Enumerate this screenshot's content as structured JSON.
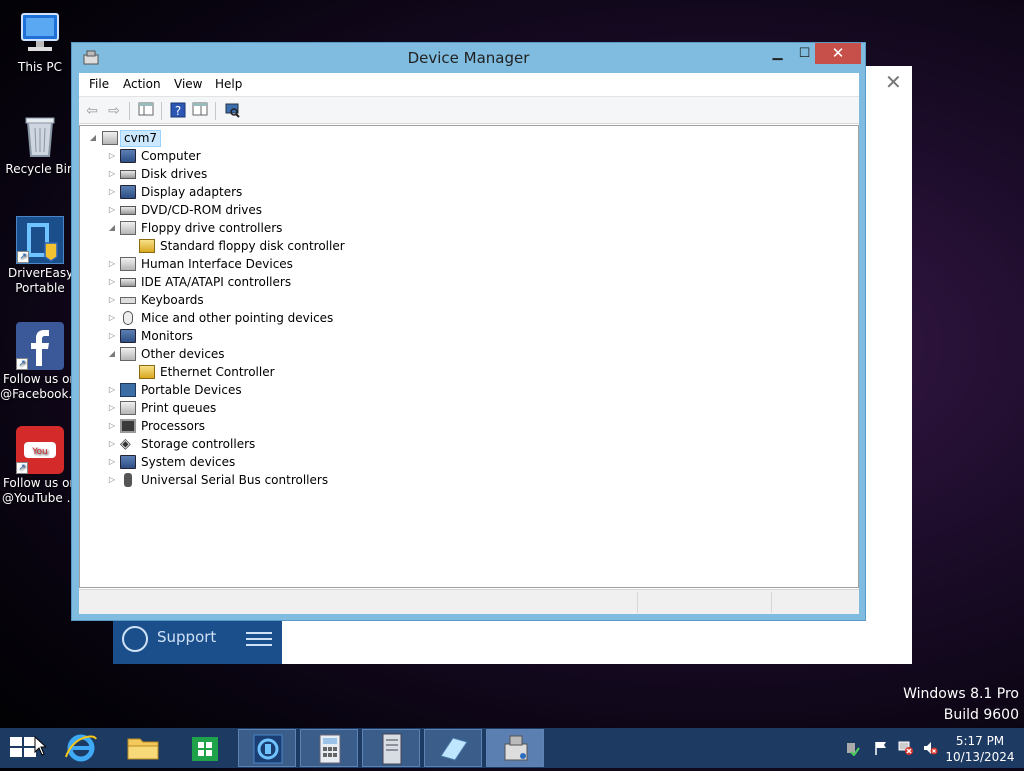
{
  "desktop": {
    "icons": [
      {
        "label": "This PC"
      },
      {
        "label": "Recycle Bin"
      },
      {
        "label": "DriverEasy Portable"
      },
      {
        "label": "Follow us on @Facebook..."
      },
      {
        "label": "Follow us on @YouTube ..."
      }
    ],
    "support_label": "Support",
    "edition": "Windows 8.1 Pro",
    "build": "Build 9600"
  },
  "window": {
    "title": "Device Manager",
    "menu": [
      "File",
      "Action",
      "View",
      "Help"
    ],
    "root": "cvm7",
    "nodes": [
      {
        "label": "Computer",
        "state": "collapsed",
        "icon": "computer-icon"
      },
      {
        "label": "Disk drives",
        "state": "collapsed",
        "icon": "disk-drive-icon"
      },
      {
        "label": "Display adapters",
        "state": "collapsed",
        "icon": "display-adapter-icon"
      },
      {
        "label": "DVD/CD-ROM drives",
        "state": "collapsed",
        "icon": "dvd-drive-icon"
      },
      {
        "label": "Floppy drive controllers",
        "state": "expanded",
        "icon": "floppy-controller-icon"
      },
      {
        "label": "Standard floppy disk controller",
        "state": "child",
        "icon": "floppy-controller-icon"
      },
      {
        "label": "Human Interface Devices",
        "state": "collapsed",
        "icon": "hid-icon"
      },
      {
        "label": "IDE ATA/ATAPI controllers",
        "state": "collapsed",
        "icon": "ide-controller-icon"
      },
      {
        "label": "Keyboards",
        "state": "collapsed",
        "icon": "keyboard-icon"
      },
      {
        "label": "Mice and other pointing devices",
        "state": "collapsed",
        "icon": "mouse-icon"
      },
      {
        "label": "Monitors",
        "state": "collapsed",
        "icon": "monitor-icon"
      },
      {
        "label": "Other devices",
        "state": "expanded",
        "icon": "other-devices-icon"
      },
      {
        "label": "Ethernet Controller",
        "state": "child",
        "icon": "warning-device-icon"
      },
      {
        "label": "Portable Devices",
        "state": "collapsed",
        "icon": "portable-device-icon"
      },
      {
        "label": "Print queues",
        "state": "collapsed",
        "icon": "printer-icon"
      },
      {
        "label": "Processors",
        "state": "collapsed",
        "icon": "processor-icon"
      },
      {
        "label": "Storage controllers",
        "state": "collapsed",
        "icon": "storage-controller-icon"
      },
      {
        "label": "System devices",
        "state": "collapsed",
        "icon": "system-device-icon"
      },
      {
        "label": "Universal Serial Bus controllers",
        "state": "collapsed",
        "icon": "usb-icon"
      }
    ]
  },
  "taskbar": {
    "time": "5:17 PM",
    "date": "10/13/2024"
  }
}
